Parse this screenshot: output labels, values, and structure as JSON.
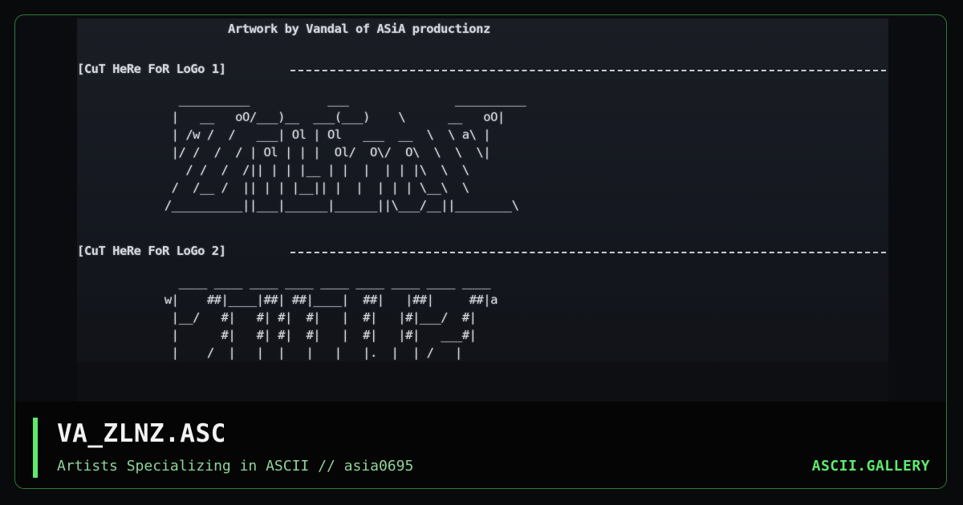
{
  "screen": {
    "credit": "Artwork by Vandal of ASiA productionz",
    "cut_label_1": "[CuT HeRe FoR LoGo 1]",
    "cut_label_2": "[CuT HeRe FoR LoGo 2]",
    "logo_1": "   __________           ___               __________\n  |   __   oO/___)__  ___(___)    \\      __   oO|\n  | /w /  /   ___| Ol | Ol   ___  __  \\  \\ a\\ |\n  |/ /  /  / | Ol | | |  Ol/  O\\/  O\\  \\  \\  \\|\n    / /  /  /|| | | |__ | |  |  | | |\\  \\  \\\n  /  /__ /  || | | |__|| |  |  | | | \\__\\  \\\n /__________||___|______|______||\\___/__||________\\",
    "logo_2": "   ____ ____ ____ ____ ____ ____ ____ ____ ____\n w|    ##|____|##| ##|____|  ##|   |##|     ##|a\n  |__/   #|   #| #|  #|   |  #|   |#|___/  #|\n  |      #|   #| #|  #|   |  #|   |#|   ___#|\n  |    /  |   |  |   |   |   |.  |  | /   |"
  },
  "footer": {
    "title": "VA_ZLNZ.ASC",
    "subtitle": "Artists Specializing in ASCII // asia0695",
    "brand": "ASCII.GALLERY"
  },
  "colors": {
    "accent": "#5eea6e",
    "subtitle": "#8fd39a",
    "title": "#f2f2f2"
  }
}
